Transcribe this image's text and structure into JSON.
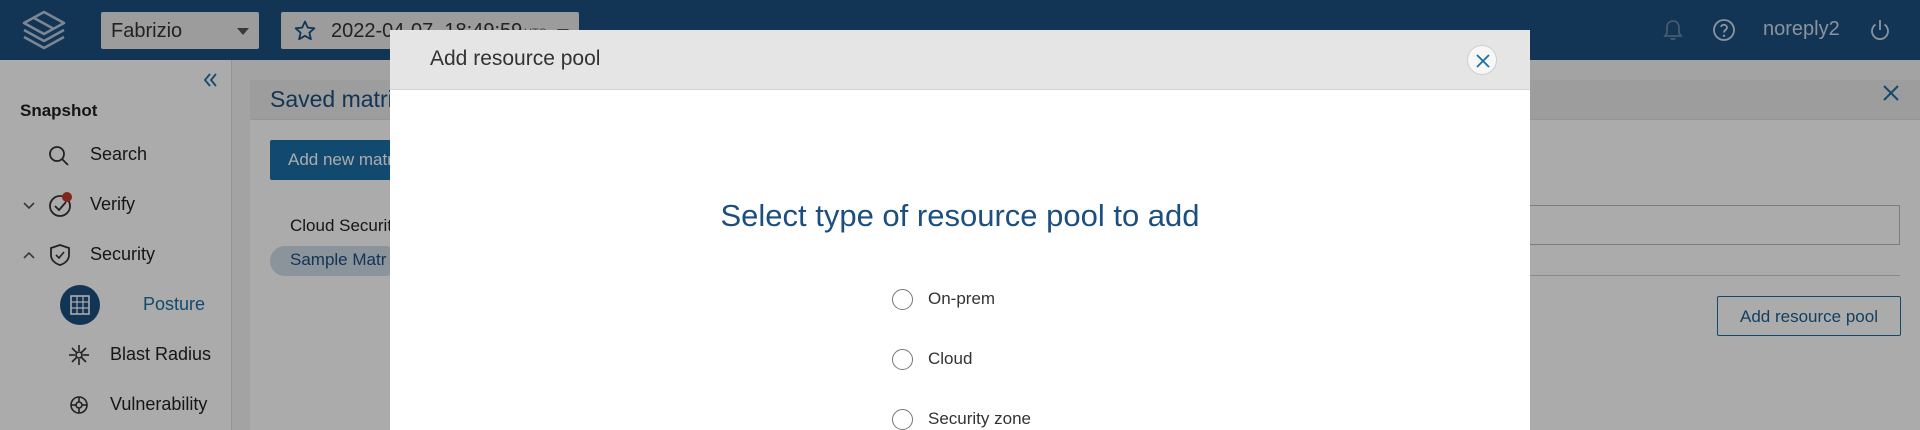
{
  "topbar": {
    "workspace": "Fabrizio",
    "snapshot_time": "2022-04-07, 18:49:59",
    "snapshot_tz": "UTC",
    "user": "noreply2"
  },
  "sidebar": {
    "heading": "Snapshot",
    "items": [
      {
        "label": "Search",
        "icon": "search-icon"
      },
      {
        "label": "Verify",
        "icon": "verify-icon"
      },
      {
        "label": "Security",
        "icon": "shield-icon"
      },
      {
        "label": "Posture",
        "icon": "posture-icon",
        "active": true
      },
      {
        "label": "Blast Radius",
        "icon": "blast-radius-icon"
      },
      {
        "label": "Vulnerability",
        "icon": "vulnerability-icon"
      }
    ]
  },
  "main": {
    "title": "Saved matri",
    "add_matrix_label": "Add new matr",
    "list": [
      "Cloud Securit",
      "Sample Matr"
    ],
    "add_pool_label": "Add resource pool"
  },
  "modal": {
    "title": "Add resource pool",
    "heading": "Select type of resource pool to add",
    "options": [
      "On-prem",
      "Cloud",
      "Security zone"
    ]
  },
  "colors": {
    "brand": "#1c4f80",
    "accent": "#1c6ea4"
  }
}
